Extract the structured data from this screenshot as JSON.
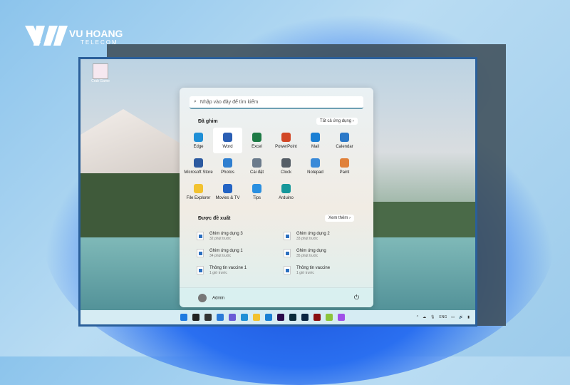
{
  "brand": {
    "name": "VU HOANG",
    "sub": "TELECOM"
  },
  "desktop": {
    "icon_label": "Crab Game"
  },
  "start_menu": {
    "search_placeholder": "Nhập vào đây để tìm kiếm",
    "pinned_title": "Đã ghim",
    "all_apps": "Tất cả ứng dụng",
    "pinned": [
      {
        "label": "Edge",
        "color": "#1f8fd6"
      },
      {
        "label": "Word",
        "color": "#2b5fb4"
      },
      {
        "label": "Excel",
        "color": "#1d7a45"
      },
      {
        "label": "PowerPoint",
        "color": "#d24726"
      },
      {
        "label": "Mail",
        "color": "#1a7fd4"
      },
      {
        "label": "Calendar",
        "color": "#2a78c8"
      },
      {
        "label": "Microsoft Store",
        "color": "#2c5aa0"
      },
      {
        "label": "Photos",
        "color": "#2f7fd0"
      },
      {
        "label": "Cài đặt",
        "color": "#6b7b8c"
      },
      {
        "label": "Clock",
        "color": "#555e66"
      },
      {
        "label": "Notepad",
        "color": "#3a8ad8"
      },
      {
        "label": "Paint",
        "color": "#e0813a"
      },
      {
        "label": "File Explorer",
        "color": "#f2c230"
      },
      {
        "label": "Movies & TV",
        "color": "#2464c4"
      },
      {
        "label": "Tips",
        "color": "#2a8fe0"
      },
      {
        "label": "Arduino",
        "color": "#16979a"
      }
    ],
    "recommended_title": "Được đề xuất",
    "more": "Xem thêm",
    "recommended": [
      {
        "title": "Ghim ứng dụng 3",
        "time": "32 phút trước"
      },
      {
        "title": "Ghim ứng dụng 2",
        "time": "33 phút trước"
      },
      {
        "title": "Ghim ứng dụng 1",
        "time": "34 phút trước"
      },
      {
        "title": "Ghim ứng dụng",
        "time": "35 phút trước"
      },
      {
        "title": "Thông tin vaccine 1",
        "time": "1 giờ trước"
      },
      {
        "title": "Thông tin vaccine",
        "time": "1 giờ trước"
      }
    ],
    "user": "Admin"
  },
  "taskbar": {
    "apps": [
      {
        "name": "start",
        "color": "#1f7ae0"
      },
      {
        "name": "search",
        "color": "#222"
      },
      {
        "name": "task-view",
        "color": "#333"
      },
      {
        "name": "widgets",
        "color": "#2b7ad8"
      },
      {
        "name": "chat",
        "color": "#6a5bd6"
      },
      {
        "name": "edge",
        "color": "#1f8fd6"
      },
      {
        "name": "file-explorer",
        "color": "#f2c230"
      },
      {
        "name": "mail",
        "color": "#1a7fd4"
      },
      {
        "name": "premiere",
        "color": "#2a0a4a"
      },
      {
        "name": "lightroom",
        "color": "#0a2a3a"
      },
      {
        "name": "photoshop",
        "color": "#0a2440"
      },
      {
        "name": "acrobat",
        "color": "#8a0f0f"
      },
      {
        "name": "chrome-canary",
        "color": "#8cc43a"
      },
      {
        "name": "messenger",
        "color": "#a050e8"
      }
    ],
    "lang": "ENG"
  }
}
